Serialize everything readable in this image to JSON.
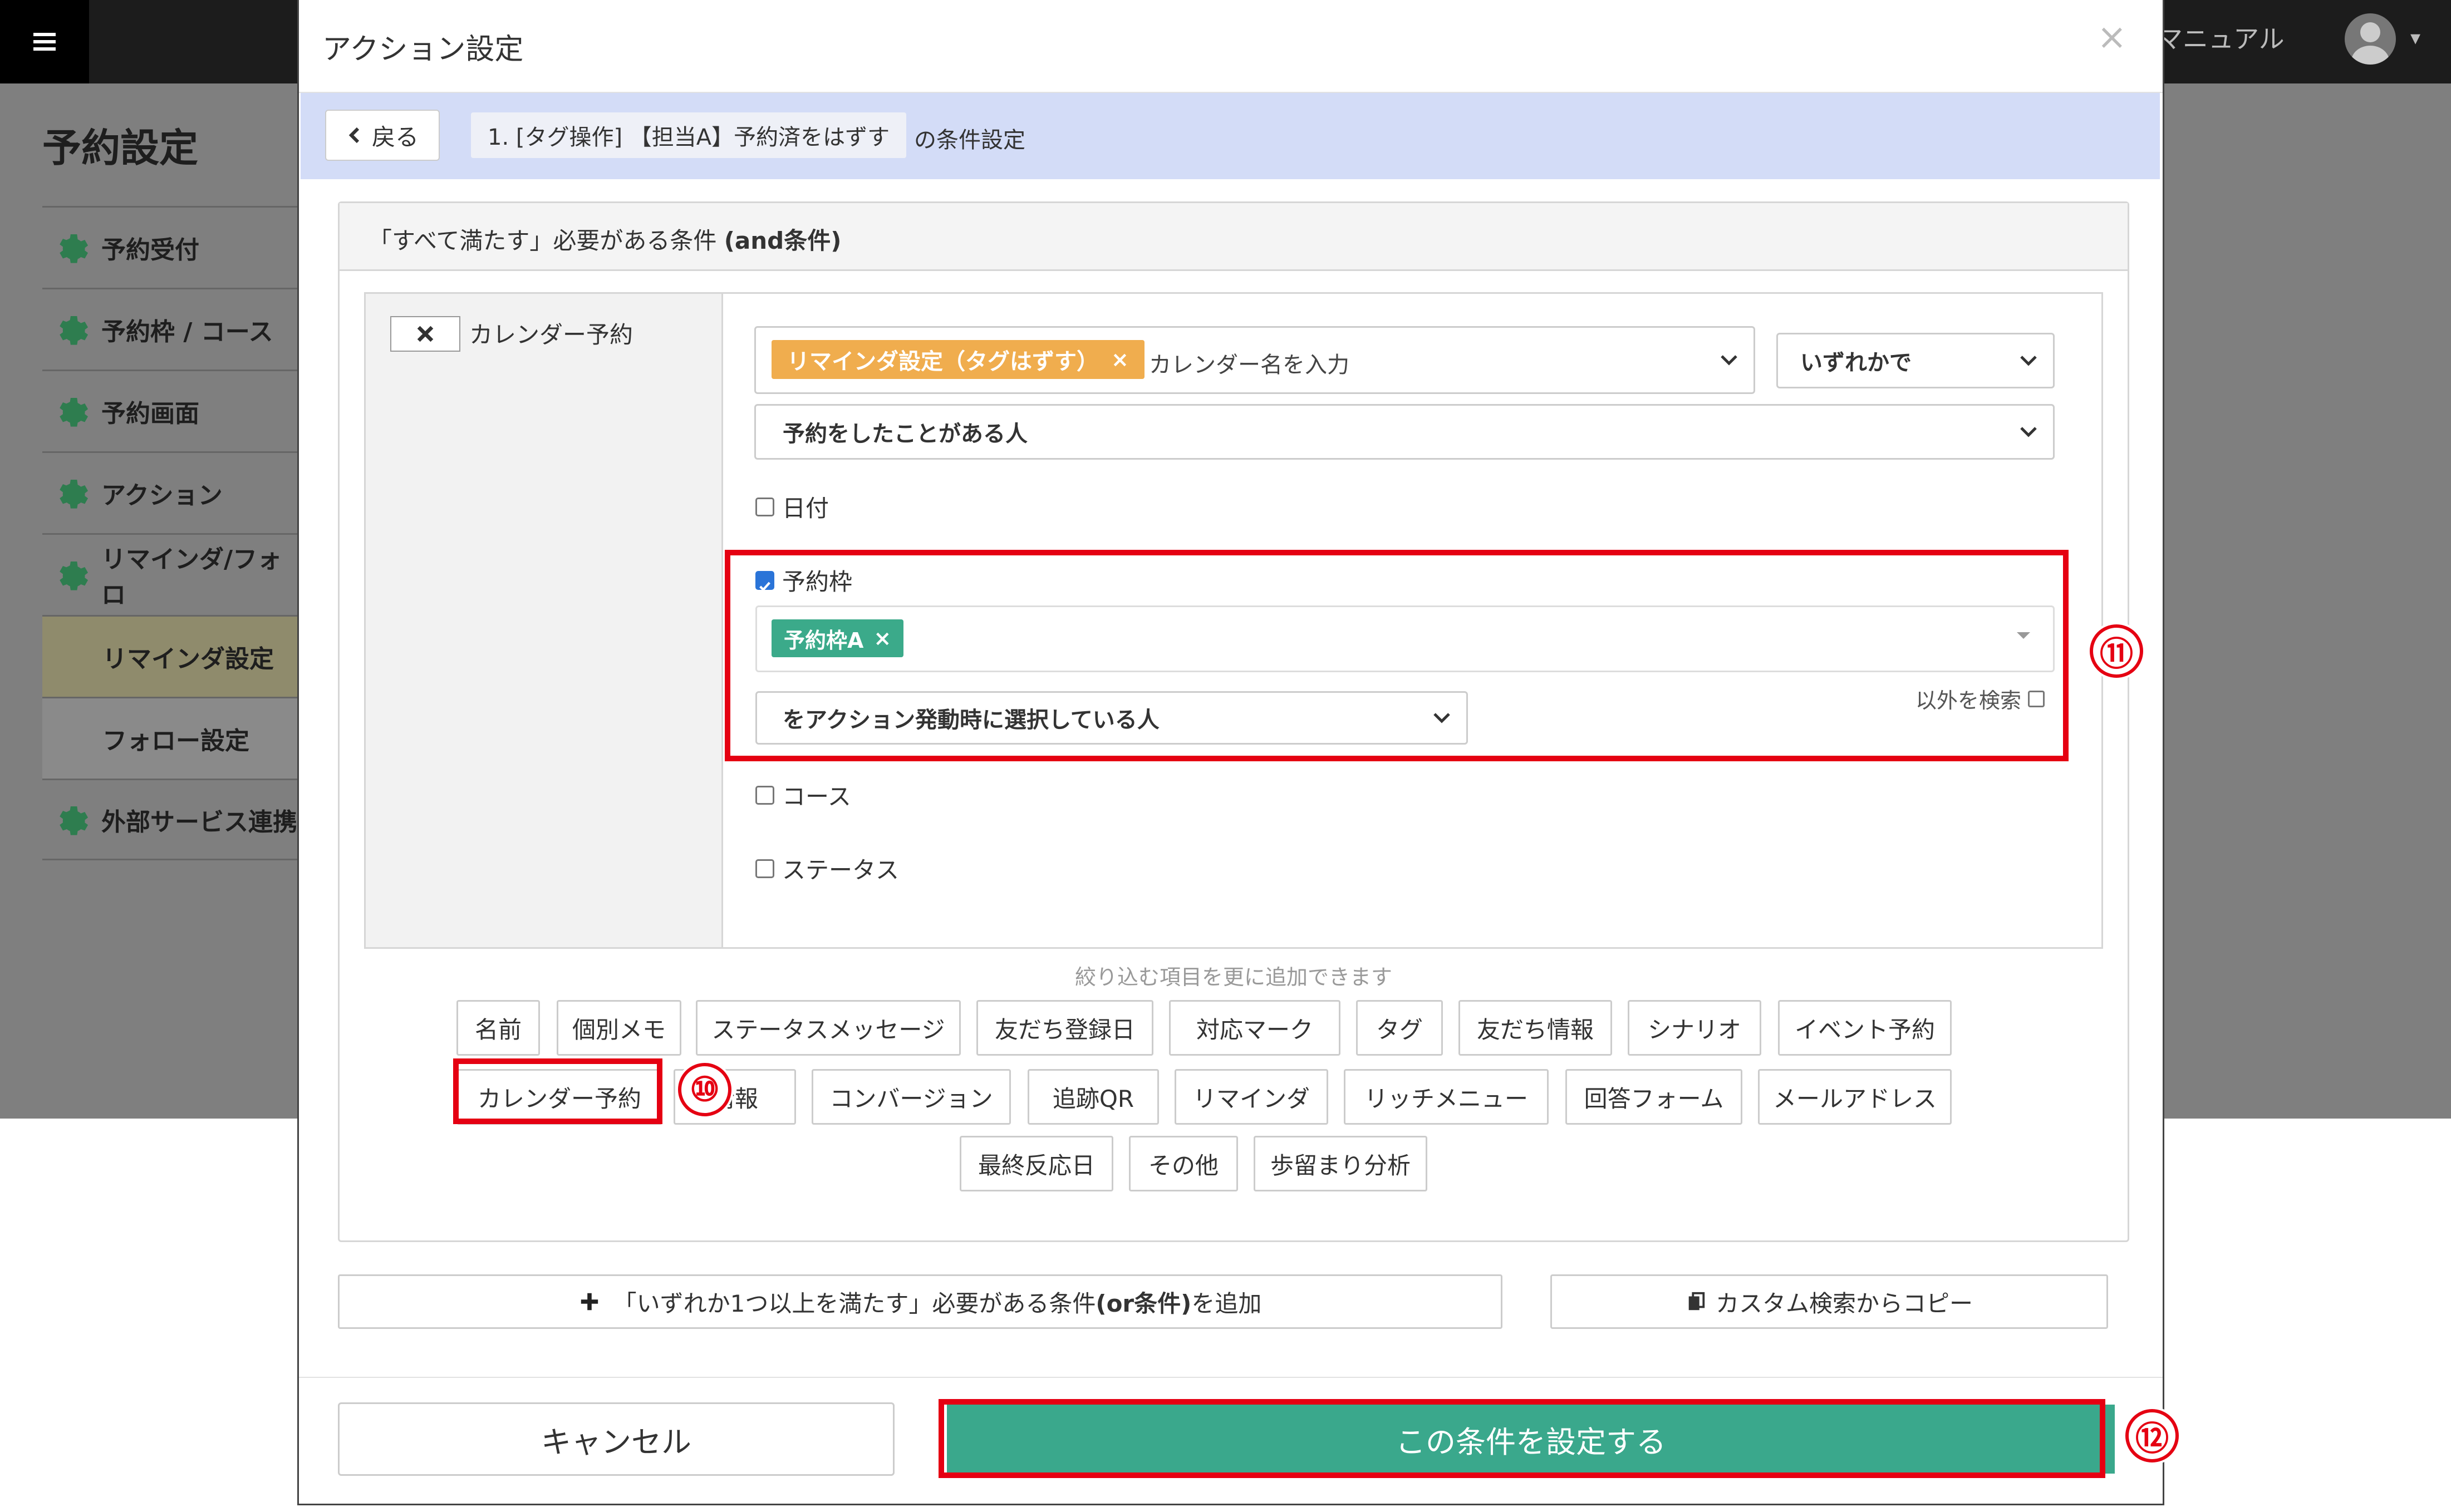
{
  "background_app": {
    "menu_icon": "hamburger-icon",
    "page_title": "予約設定",
    "manual_link": "マニュアル",
    "sidebar": [
      {
        "label": "予約受付",
        "icon": "gear-icon"
      },
      {
        "label": "予約枠 / コース",
        "icon": "gear-icon"
      },
      {
        "label": "予約画面",
        "icon": "gear-icon"
      },
      {
        "label": "アクション",
        "icon": "gear-icon"
      },
      {
        "label": "リマインダ/フォロ",
        "icon": "gear-icon"
      },
      {
        "label": "リマインダ設定",
        "sub": true,
        "active": true
      },
      {
        "label": "フォロー設定",
        "sub": true
      },
      {
        "label": "外部サービス連携",
        "icon": "gear-icon"
      }
    ]
  },
  "modal": {
    "title": "アクション設定",
    "close": "×",
    "context": {
      "back_label": "戻る",
      "crumb": "1. [タグ操作] 【担当A】予約済をはずす",
      "suffix": "の条件設定"
    },
    "and_panel": {
      "title_prefix": "「すべて満たす」必要がある条件 ",
      "title_bold": "(and条件)",
      "condition": {
        "remove_label": "✖",
        "name": "カレンダー予約",
        "calendar_tag": "リマインダ設定（タグはずす）",
        "calendar_tag_remove": "×",
        "calendar_placeholder": "カレンダー名を入力",
        "match_mode": "いずれかで",
        "reserve_mode": "予約をしたことがある人",
        "options": {
          "date": {
            "label": "日付",
            "checked": false
          },
          "frame": {
            "label": "予約枠",
            "checked": true
          },
          "course": {
            "label": "コース",
            "checked": false
          },
          "status": {
            "label": "ステータス",
            "checked": false
          }
        },
        "frame_chip": "予約枠A",
        "frame_chip_remove": "×",
        "exclude_label": "以外を検索",
        "action_select": "をアクション発動時に選択している人"
      },
      "hint": "絞り込む項目を更に追加できます",
      "filter_rows": [
        [
          "名前",
          "個別メモ",
          "ステータスメッセージ",
          "友だち登録日",
          "対応マーク",
          "タグ",
          "友だち情報",
          "シナリオ",
          "イベント予約"
        ],
        [
          "カレンダー予約",
          "情報",
          "コンバージョン",
          "追跡QR",
          "リマインダ",
          "リッチメニュー",
          "回答フォーム",
          "メールアドレス"
        ],
        [
          "最終反応日",
          "その他",
          "歩留まり分析"
        ]
      ]
    },
    "or_button_prefix": "「いずれか1つ以上を満たす」必要がある条件",
    "or_button_bold": "(or条件)",
    "or_button_suffix": "を追加",
    "copy_button": "カスタム検索からコピー",
    "cancel": "キャンセル",
    "submit": "この条件を設定する"
  },
  "annotations": {
    "color": "#e50012",
    "numbers": [
      "⑩",
      "⑪",
      "⑫"
    ]
  },
  "colors": {
    "primary": "#3aa88c",
    "tag_chip": "#f0ad4e",
    "frame_chip": "#3baa8a",
    "context_bar": "#d3dcf7"
  }
}
